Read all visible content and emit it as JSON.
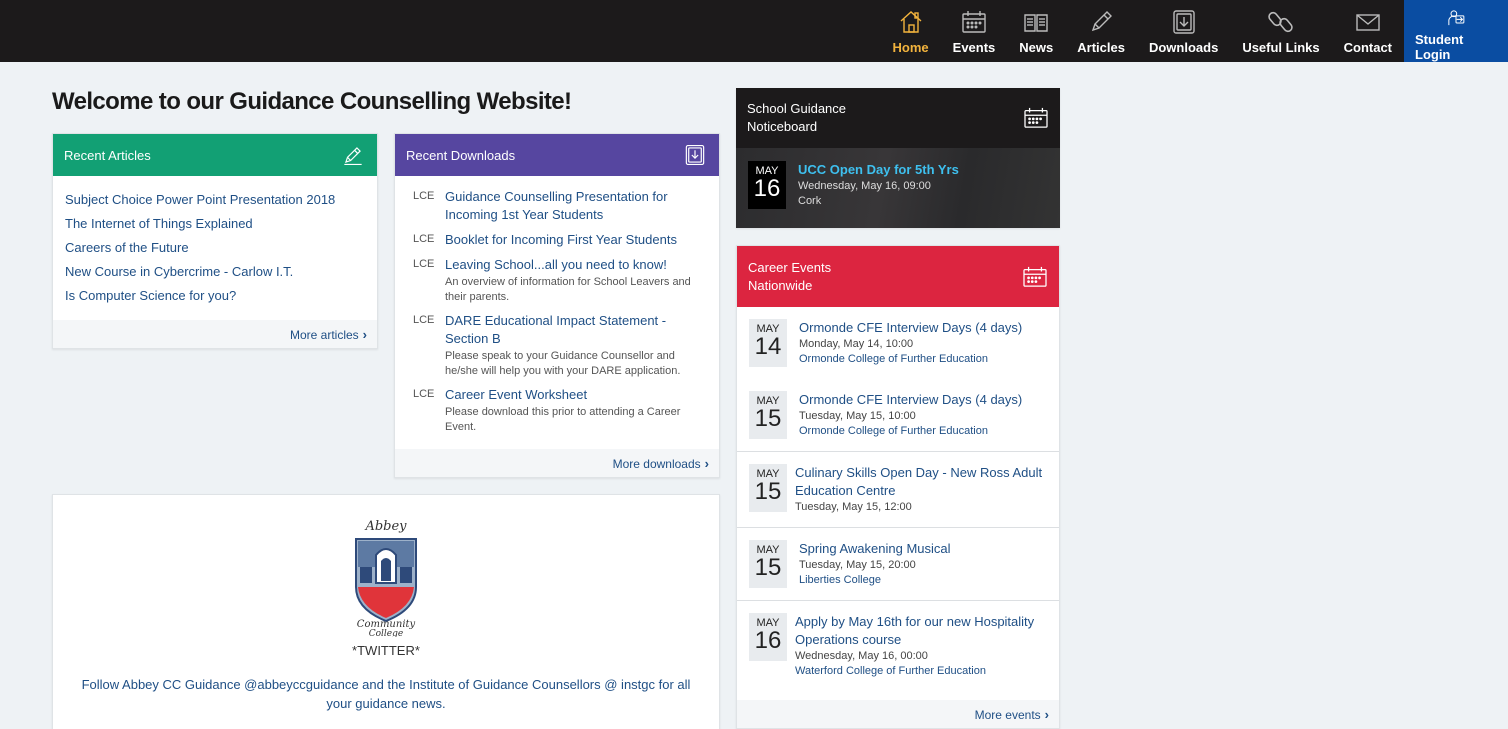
{
  "nav": {
    "items": [
      {
        "label": "Home",
        "icon": "home-icon",
        "active": true
      },
      {
        "label": "Events",
        "icon": "calendar-icon"
      },
      {
        "label": "News",
        "icon": "newspaper-icon"
      },
      {
        "label": "Articles",
        "icon": "pencil-icon"
      },
      {
        "label": "Downloads",
        "icon": "download-icon"
      },
      {
        "label": "Useful Links",
        "icon": "link-icon"
      },
      {
        "label": "Contact",
        "icon": "envelope-icon"
      },
      {
        "label": "Student Login",
        "icon": "user-login-icon"
      }
    ]
  },
  "page": {
    "title": "Welcome to our Guidance Counselling Website!"
  },
  "articles": {
    "heading": "Recent Articles",
    "items": [
      "Subject Choice Power Point Presentation 2018",
      "The Internet of Things Explained",
      "Careers of the Future",
      "New Course in Cybercrime - Carlow I.T.",
      "Is Computer Science for you?"
    ],
    "more": "More articles"
  },
  "downloads": {
    "heading": "Recent Downloads",
    "items": [
      {
        "tag": "LCE",
        "title": "Guidance Counselling Presentation for Incoming 1st Year Students",
        "desc": ""
      },
      {
        "tag": "LCE",
        "title": "Booklet for Incoming First Year Students",
        "desc": ""
      },
      {
        "tag": "LCE",
        "title": "Leaving School...all you need to know!",
        "desc": "An overview of information for School Leavers and their parents."
      },
      {
        "tag": "LCE",
        "title": "DARE Educational Impact Statement - Section B",
        "desc": "Please speak to your Guidance Counsellor and he/she will help you with your DARE application."
      },
      {
        "tag": "LCE",
        "title": "Career Event Worksheet",
        "desc": "Please download this prior to attending a Career Event."
      }
    ],
    "more": "More downloads"
  },
  "twitter": {
    "crest_text_top": "Abbey",
    "crest_text_bottom": "Community College",
    "title": "*TWITTER*",
    "text": "Follow Abbey CC Guidance @abbeyccguidance and the Institute of Guidance Counsellors @ instgc for all your guidance news."
  },
  "noticeboard": {
    "heading_line1": "School Guidance",
    "heading_line2": "Noticeboard",
    "event": {
      "month": "MAY",
      "day": "16",
      "title": "UCC Open Day for 5th Yrs",
      "when": "Wednesday, May 16, 09:00",
      "where": "Cork"
    }
  },
  "career": {
    "heading_line1": "Career Events",
    "heading_line2": "Nationwide",
    "events": [
      {
        "month": "MAY",
        "day": "14",
        "title": "Ormonde CFE Interview Days (4 days)",
        "when": "Monday, May 14, 10:00",
        "where": "Ormonde College of Further Education"
      },
      {
        "month": "MAY",
        "day": "15",
        "title": "Ormonde CFE Interview Days (4 days)",
        "when": "Tuesday, May 15, 10:00",
        "where": "Ormonde College of Further Education"
      },
      {
        "month": "MAY",
        "day": "15",
        "title": "Culinary Skills Open Day - New Ross Adult Education Centre",
        "when": "Tuesday, May 15, 12:00",
        "where": ""
      },
      {
        "month": "MAY",
        "day": "15",
        "title": "Spring Awakening Musical",
        "when": "Tuesday, May 15, 20:00",
        "where": "Liberties College"
      },
      {
        "month": "MAY",
        "day": "16",
        "title": "Apply by May 16th for our new Hospitality Operations course",
        "when": "Wednesday, May 16, 00:00",
        "where": "Waterford College of Further Education"
      }
    ],
    "more": "More events"
  },
  "colors": {
    "nav_bg": "#1c1a1b",
    "nav_active": "#f2b33d",
    "login_bg": "#0a4da2",
    "articles_head": "#12a074",
    "downloads_head": "#5646a0",
    "career_head": "#dc2540",
    "link": "#1f4f85"
  }
}
